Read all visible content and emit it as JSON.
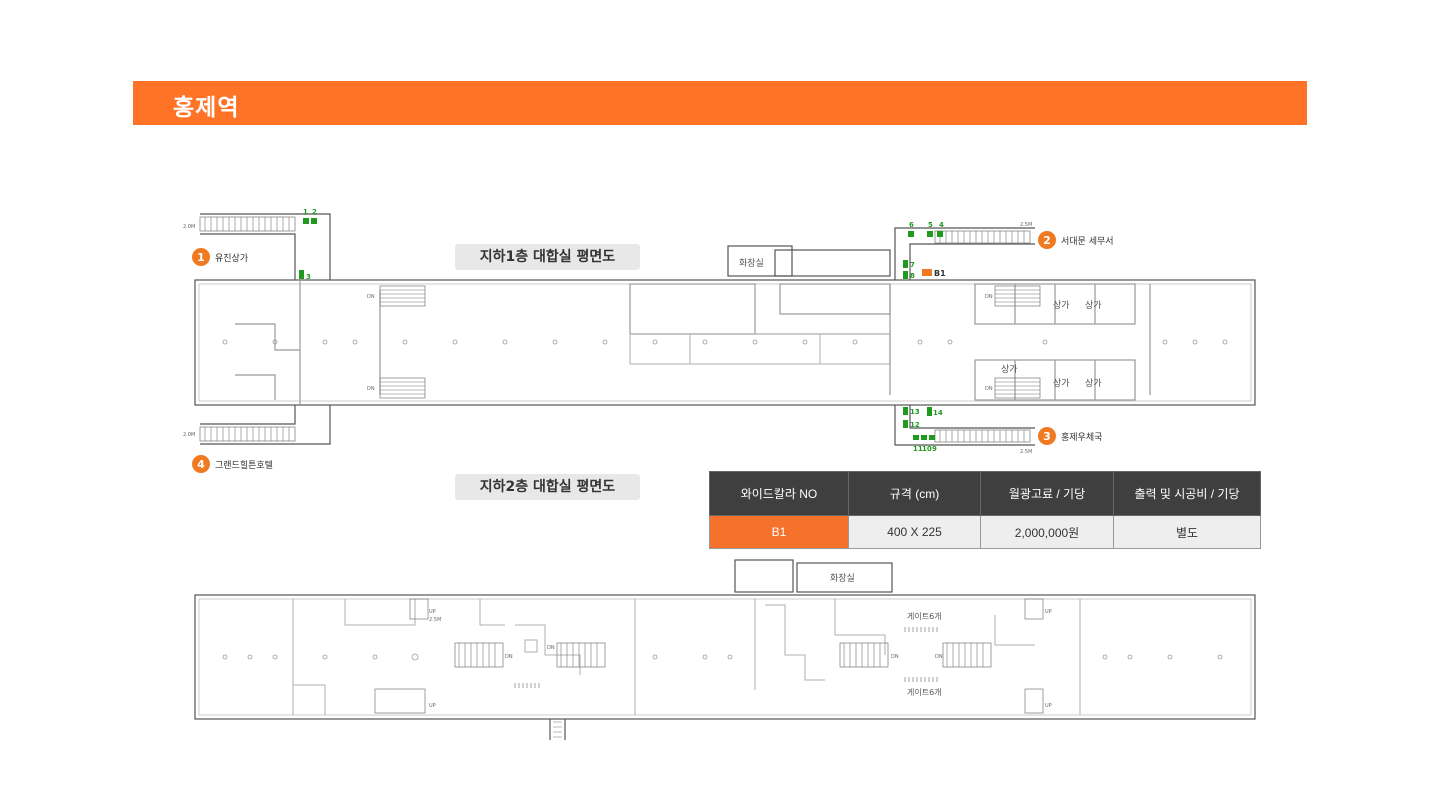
{
  "page": {
    "title": "홍제역"
  },
  "floor_b1": {
    "label": "지하1층 대합실 평면도",
    "exits": [
      {
        "num": "1",
        "name": "유진상가"
      },
      {
        "num": "2",
        "name": "서대문 세무서"
      },
      {
        "num": "3",
        "name": "홍제우체국"
      },
      {
        "num": "4",
        "name": "그랜드힐튼호텔"
      }
    ],
    "restroom": "화장실",
    "shops": [
      "상가",
      "상가",
      "상가",
      "상가",
      "상가"
    ],
    "ad_marker": "B1",
    "ad_numbers": [
      "1",
      "2",
      "3",
      "6",
      "5",
      "4",
      "7",
      "8",
      "13",
      "12",
      "14",
      "11",
      "10",
      "9"
    ],
    "stair_width": "2.5M",
    "stair_width_alt": "2.0M",
    "dn": "DN"
  },
  "floor_b2": {
    "label": "지하2층 대합실 평면도",
    "restroom": "화장실",
    "gate_top": "게이트6개",
    "gate_bottom": "게이트6개",
    "up": "UP",
    "dn": "DN",
    "stair_width": "2.5M"
  },
  "spec_table": {
    "headers": [
      "와이드칼라 NO",
      "규격 (cm)",
      "월광고료 / 기당",
      "출력 및 시공비 / 기당"
    ],
    "rows": [
      [
        "B1",
        "400 X 225",
        "2,000,000원",
        "별도"
      ]
    ]
  },
  "colors": {
    "accent": "#ff7327",
    "marker_green": "#1f9a1f",
    "marker_orange": "#f07a22",
    "wall": "#555555"
  }
}
